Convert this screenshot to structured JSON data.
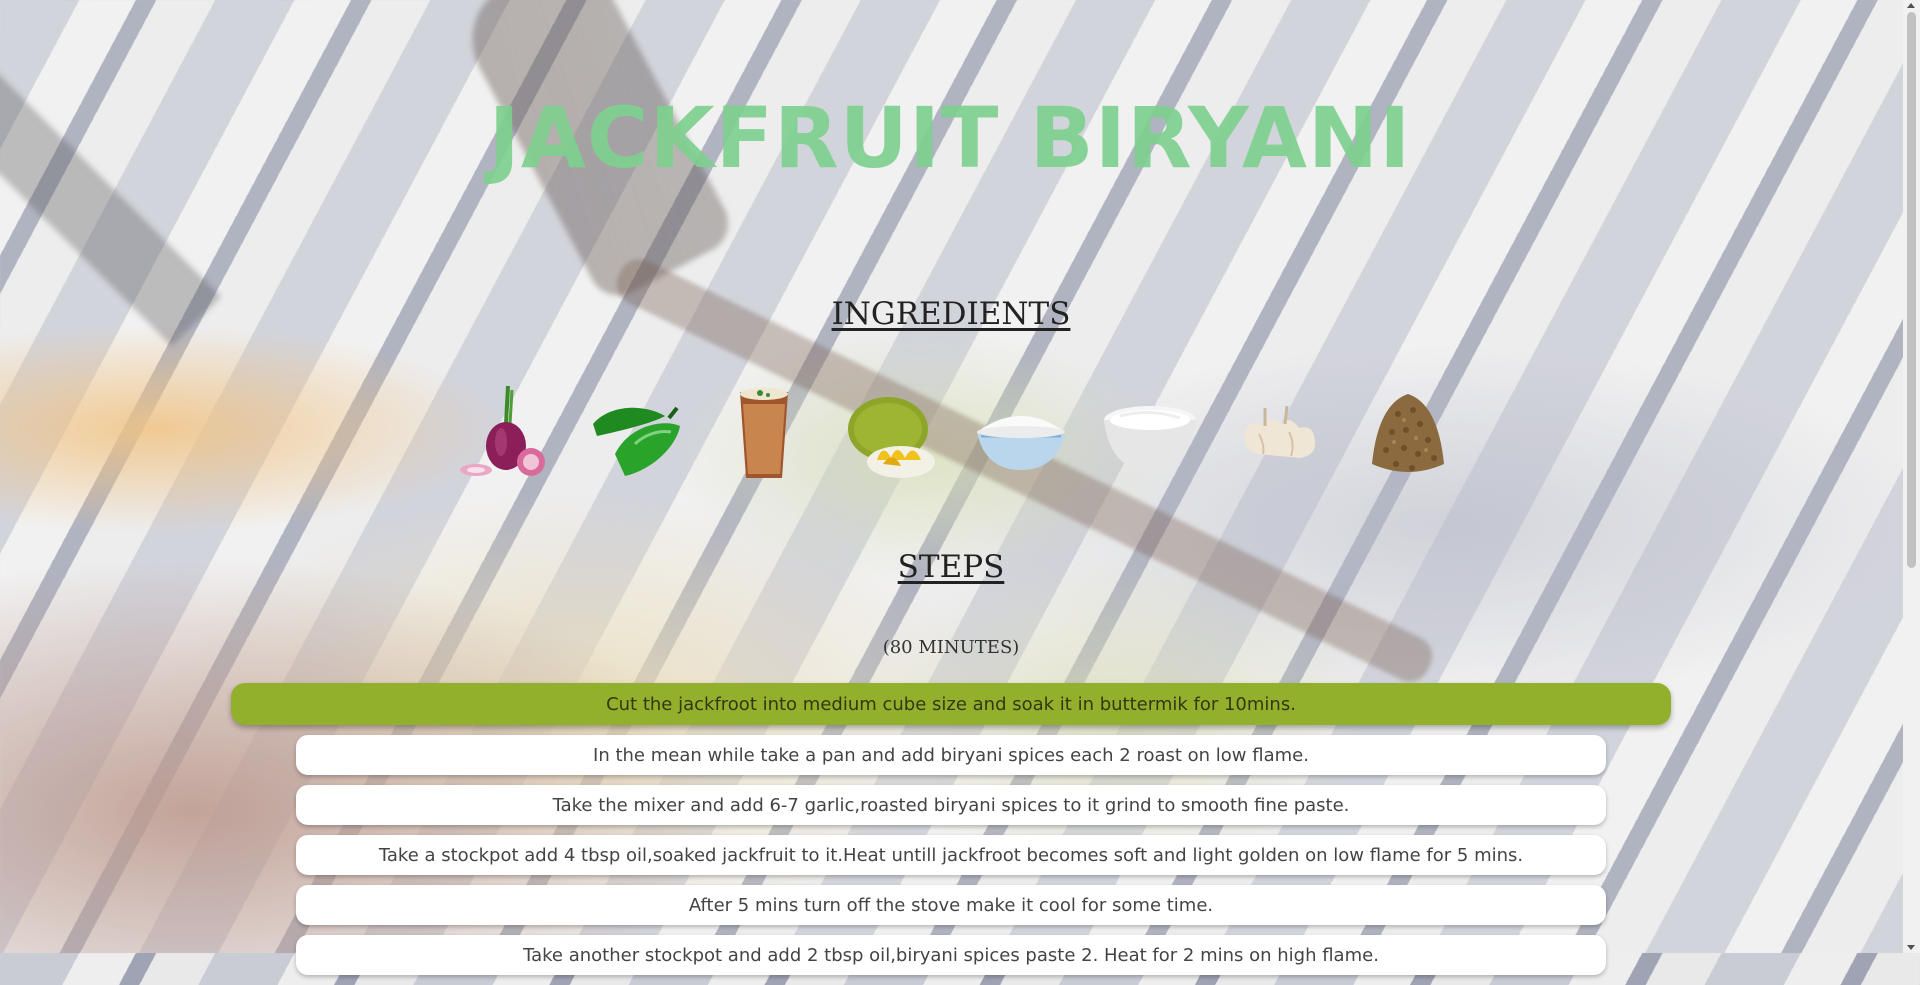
{
  "page": {
    "title": "JACKFRUIT BIRYANI",
    "title_color": "#7fd08f",
    "accent_color": "#93b02d"
  },
  "ingredients": {
    "heading": "INGREDIENTS",
    "items": [
      {
        "name": "onion-icon"
      },
      {
        "name": "green-chili-icon"
      },
      {
        "name": "buttermilk-icon"
      },
      {
        "name": "jackfruit-icon"
      },
      {
        "name": "rice-icon"
      },
      {
        "name": "curd-icon"
      },
      {
        "name": "garlic-icon"
      },
      {
        "name": "coriander-seeds-icon"
      }
    ]
  },
  "steps": {
    "heading": "STEPS",
    "duration": "(80 MINUTES)",
    "items": [
      "Cut the jackfroot into medium cube size and soak it in buttermik for 10mins.",
      "In the mean while take a pan and add biryani spices each 2 roast on low flame.",
      "Take the mixer and add 6-7 garlic,roasted biryani spices to it grind to smooth fine paste.",
      "Take a stockpot add 4 tbsp oil,soaked jackfruit to it.Heat untill jackfroot becomes soft and light golden on low flame for 5 mins.",
      "After 5 mins turn off the stove make it cool for some time.",
      "Take another stockpot and add 2 tbsp oil,biryani spices paste 2. Heat for 2 mins on high flame."
    ]
  }
}
